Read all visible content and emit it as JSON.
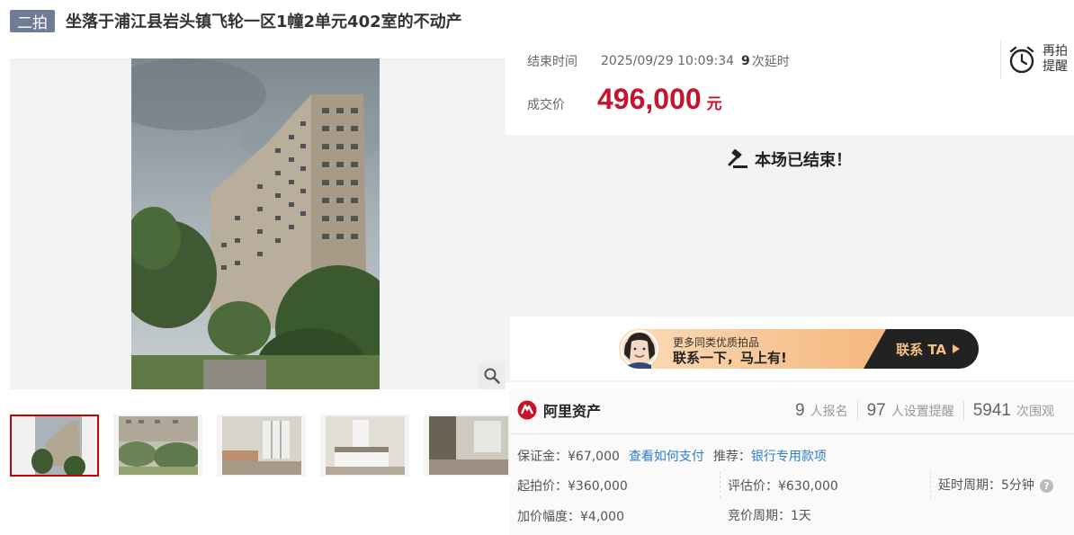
{
  "title": {
    "badge": "二拍",
    "text": "坐落于浦江县岩头镇飞轮一区1幢2单元402室的不动产"
  },
  "auction": {
    "end_label": "结束时间",
    "end_time": "2025/09/29 10:09:34",
    "delay_count": "9",
    "delay_text": "次延时",
    "price_label": "成交价",
    "price_value": "496,000",
    "price_unit": "元",
    "remind_line1": "再拍",
    "remind_line2": "提醒",
    "ended_text": "本场已结束！"
  },
  "contact": {
    "line1": "更多同类优质拍品",
    "line2": "联系一下，马上有!",
    "button": "联系 TA"
  },
  "brand": {
    "name": "阿里资产"
  },
  "stats": [
    {
      "num": "9",
      "label": "人报名"
    },
    {
      "num": "97",
      "label": "人设置提醒"
    },
    {
      "num": "5941",
      "label": "次围观"
    }
  ],
  "details": {
    "deposit": "保证金：¥67,000",
    "pay_link": "查看如何支付",
    "recommend_label": "推荐：",
    "recommend_link": "银行专用款项",
    "start_price": "起拍价：¥360,000",
    "appraisal": "评估价：¥630,000",
    "delay_period": "延时周期：5分钟",
    "increment": "加价幅度：¥4,000",
    "bid_period": "竞价周期：1天"
  },
  "colors": {
    "accent_red": "#c4152e",
    "badge_bg": "#6f7c95",
    "link_blue": "#2d7ecb"
  },
  "icons": [
    "zoom-icon",
    "alarm-clock-icon",
    "gavel-icon",
    "play-triangle-icon",
    "ali-asset-logo-icon",
    "help-icon"
  ]
}
